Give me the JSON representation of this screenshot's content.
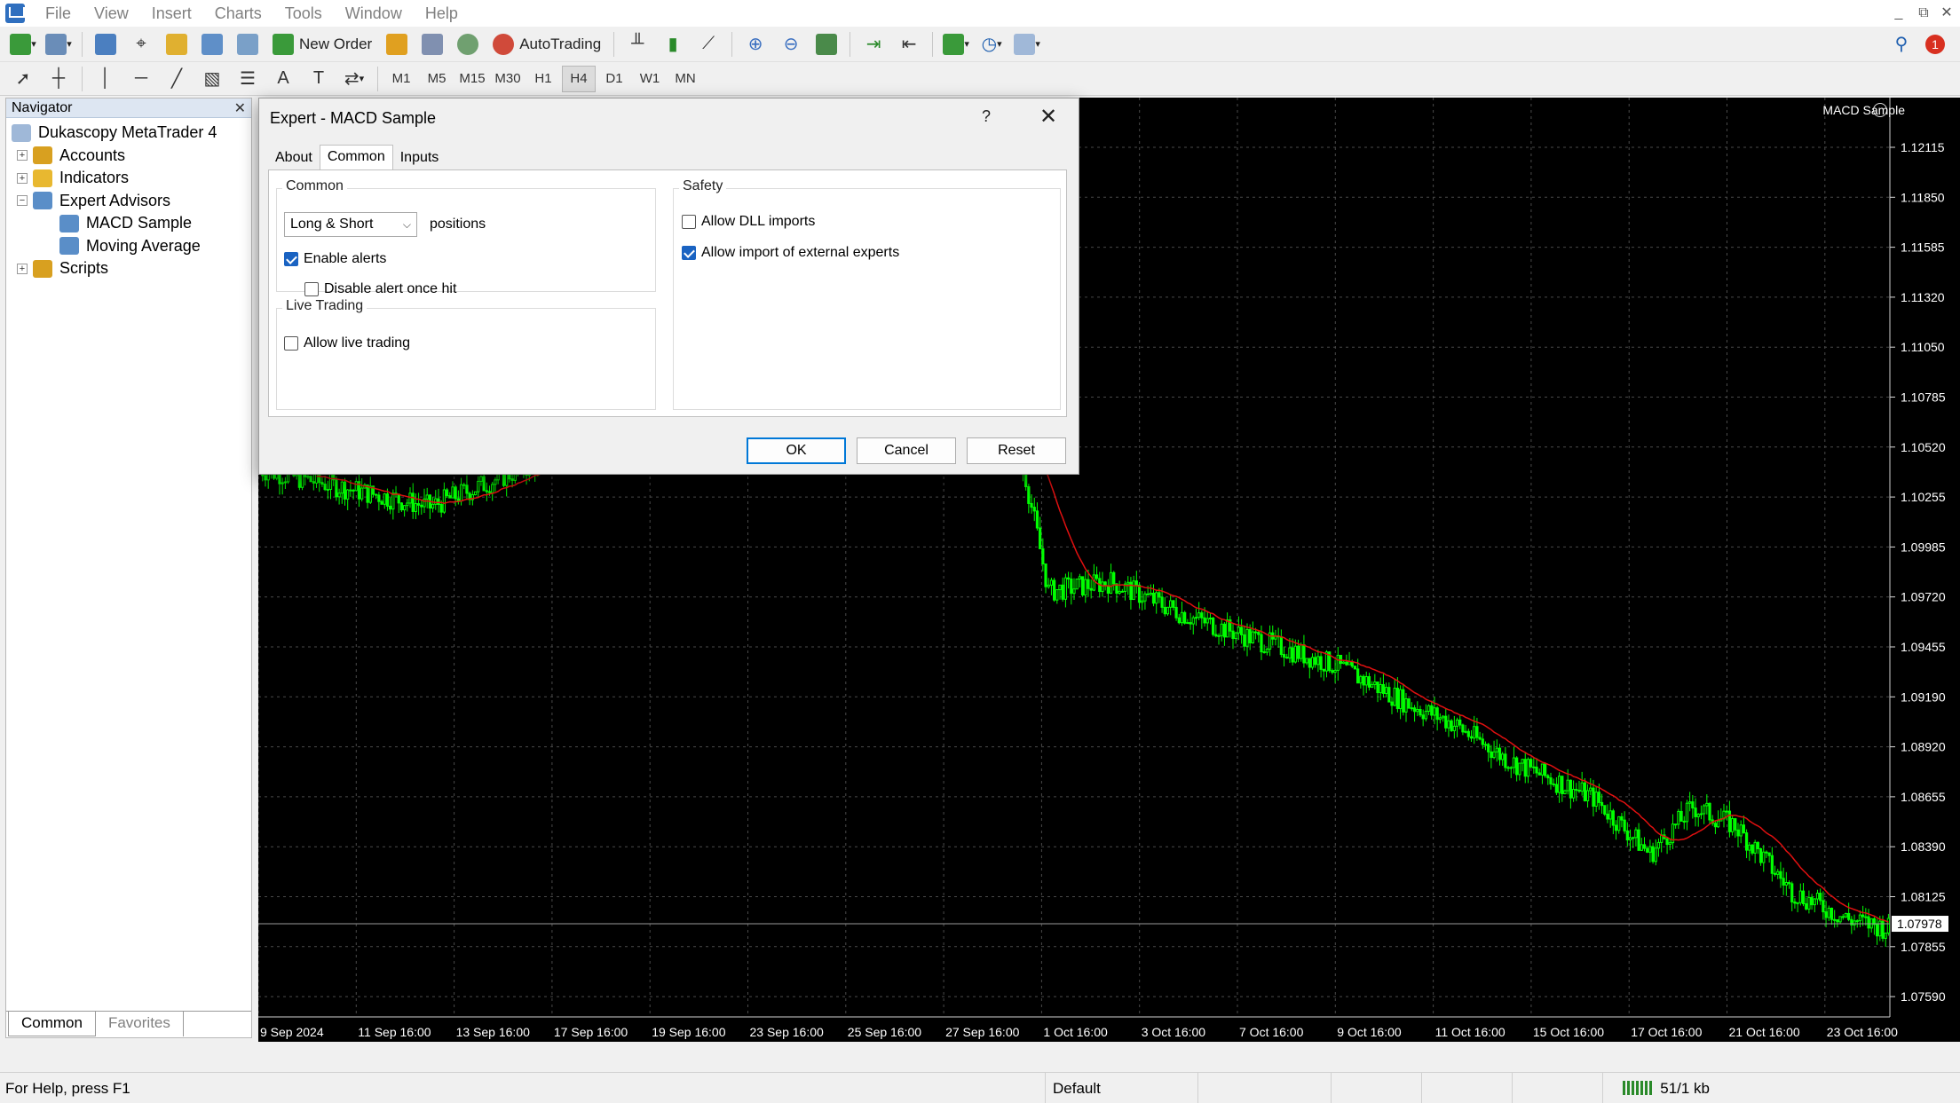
{
  "menu": [
    "File",
    "View",
    "Insert",
    "Charts",
    "Tools",
    "Window",
    "Help"
  ],
  "window_controls": [
    "_",
    "⧉",
    "✕"
  ],
  "toolbar": {
    "new_order": "New Order",
    "auto_trading": "AutoTrading",
    "notification_count": "1",
    "timeframes": [
      "M1",
      "M5",
      "M15",
      "M30",
      "H1",
      "H4",
      "D1",
      "W1",
      "MN"
    ],
    "active_timeframe": "H4"
  },
  "navigator": {
    "title": "Navigator",
    "root": "Dukascopy MetaTrader 4",
    "items": [
      {
        "label": "Accounts",
        "expander": "+",
        "indent": 0,
        "icon_color": "#d8a020"
      },
      {
        "label": "Indicators",
        "expander": "+",
        "indent": 0,
        "icon_color": "#e8b830"
      },
      {
        "label": "Expert Advisors",
        "expander": "-",
        "indent": 0,
        "icon_color": "#5a8ec8"
      },
      {
        "label": "MACD Sample",
        "expander": "",
        "indent": 1,
        "icon_color": "#5a8ec8"
      },
      {
        "label": "Moving Average",
        "expander": "",
        "indent": 1,
        "icon_color": "#5a8ec8"
      },
      {
        "label": "Scripts",
        "expander": "+",
        "indent": 0,
        "icon_color": "#d8a020"
      }
    ],
    "tabs": [
      "Common",
      "Favorites"
    ],
    "active_tab": "Common"
  },
  "chart": {
    "title": "MACD Sample",
    "current_price": "1.07978",
    "y_labels": [
      "1.12115",
      "1.11850",
      "1.11585",
      "1.11320",
      "1.11050",
      "1.10785",
      "1.10520",
      "1.10255",
      "1.09985",
      "1.09720",
      "1.09455",
      "1.09190",
      "1.08920",
      "1.08655",
      "1.08390",
      "1.08125",
      "1.07855",
      "1.07590"
    ],
    "x_labels": [
      "9 Sep 2024",
      "11 Sep 16:00",
      "13 Sep 16:00",
      "17 Sep 16:00",
      "19 Sep 16:00",
      "23 Sep 16:00",
      "25 Sep 16:00",
      "27 Sep 16:00",
      "1 Oct 16:00",
      "3 Oct 16:00",
      "7 Oct 16:00",
      "9 Oct 16:00",
      "11 Oct 16:00",
      "15 Oct 16:00",
      "17 Oct 16:00",
      "21 Oct 16:00",
      "23 Oct 16:00"
    ],
    "bg_color": "#000000",
    "candle_color": "#00ff00",
    "ma_color": "#e01010"
  },
  "dialog": {
    "title": "Expert - MACD Sample",
    "help": "?",
    "close": "✕",
    "tabs": [
      "About",
      "Common",
      "Inputs"
    ],
    "active_tab": "Common",
    "common_group": "Common",
    "positions_value": "Long & Short",
    "positions_label": "positions",
    "enable_alerts": "Enable alerts",
    "disable_alert_once_hit": "Disable alert once hit",
    "live_trading_group": "Live Trading",
    "allow_live_trading": "Allow live trading",
    "safety_group": "Safety",
    "allow_dll_imports": "Allow DLL imports",
    "allow_external_experts": "Allow import of external experts",
    "ok": "OK",
    "cancel": "Cancel",
    "reset": "Reset"
  },
  "status": {
    "help": "For Help, press F1",
    "profile": "Default",
    "traffic": "51/1 kb"
  }
}
